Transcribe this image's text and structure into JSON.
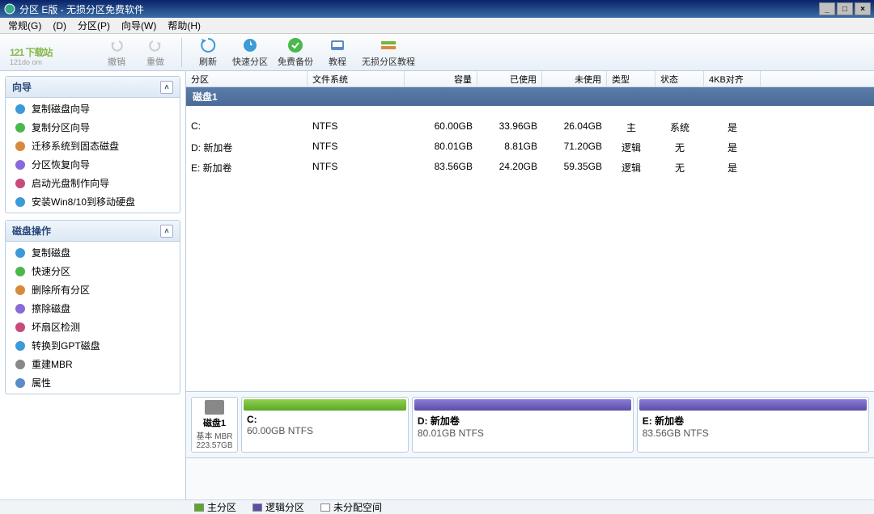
{
  "window": {
    "title": "分区    E版 - 无损分区免费软件"
  },
  "menu": [
    "常规(G)",
    "  (D)",
    "分区(P)",
    "向导(W)",
    "帮助(H)"
  ],
  "watermark": {
    "logo": "121 下载站",
    "sub": "121do    om"
  },
  "toolbar": [
    {
      "label": "撤销",
      "icon": "undo-icon",
      "enabled": false
    },
    {
      "label": "重做",
      "icon": "redo-icon",
      "enabled": false
    },
    {
      "sep": true
    },
    {
      "label": "刷新",
      "icon": "refresh-icon",
      "enabled": true
    },
    {
      "label": "快速分区",
      "icon": "fast-partition-icon",
      "enabled": true
    },
    {
      "label": "免费备份",
      "icon": "backup-icon",
      "enabled": true
    },
    {
      "label": "教程",
      "icon": "tutorial-icon",
      "enabled": true
    },
    {
      "label": "无损分区教程",
      "icon": "lossless-tutorial-icon",
      "enabled": true
    }
  ],
  "sidebar": {
    "wizard": {
      "title": "向导",
      "items": [
        "复制磁盘向导",
        "复制分区向导",
        "迁移系统到固态磁盘",
        "分区恢复向导",
        "启动光盘制作向导",
        "安装Win8/10到移动硬盘"
      ]
    },
    "ops": {
      "title": "磁盘操作",
      "items": [
        "复制磁盘",
        "快速分区",
        "删除所有分区",
        "擦除磁盘",
        "坏扇区检测",
        "转换到GPT磁盘",
        "重建MBR",
        "属性"
      ]
    }
  },
  "table": {
    "columns": [
      "分区",
      "文件系统",
      "容量",
      "已使用",
      "未使用",
      "类型",
      "状态",
      "4KB对齐"
    ],
    "disk_label": "磁盘1",
    "rows": [
      {
        "part": "C:",
        "fs": "NTFS",
        "cap": "60.00GB",
        "used": "33.96GB",
        "free": "26.04GB",
        "type": "主",
        "status": "系统",
        "align": "是"
      },
      {
        "part": "D: 新加卷",
        "fs": "NTFS",
        "cap": "80.01GB",
        "used": "8.81GB",
        "free": "71.20GB",
        "type": "逻辑",
        "status": "无",
        "align": "是"
      },
      {
        "part": "E: 新加卷",
        "fs": "NTFS",
        "cap": "83.56GB",
        "used": "24.20GB",
        "free": "59.35GB",
        "type": "逻辑",
        "status": "无",
        "align": "是"
      }
    ]
  },
  "diskmap": {
    "disk": {
      "name": "磁盘1",
      "type": "基本 MBR",
      "size": "223.57GB"
    },
    "parts": [
      {
        "name": "C:",
        "size": "60.00GB NTFS",
        "color": "green",
        "flex": 60
      },
      {
        "name": "D: 新加卷",
        "size": "80.01GB NTFS",
        "color": "purple",
        "flex": 80
      },
      {
        "name": "E: 新加卷",
        "size": "83.56GB NTFS",
        "color": "purple",
        "flex": 84
      }
    ]
  },
  "legend": [
    {
      "label": "主分区",
      "class": "sw-green"
    },
    {
      "label": "逻辑分区",
      "class": "sw-purple"
    },
    {
      "label": "未分配空间",
      "class": "sw-empty"
    }
  ]
}
